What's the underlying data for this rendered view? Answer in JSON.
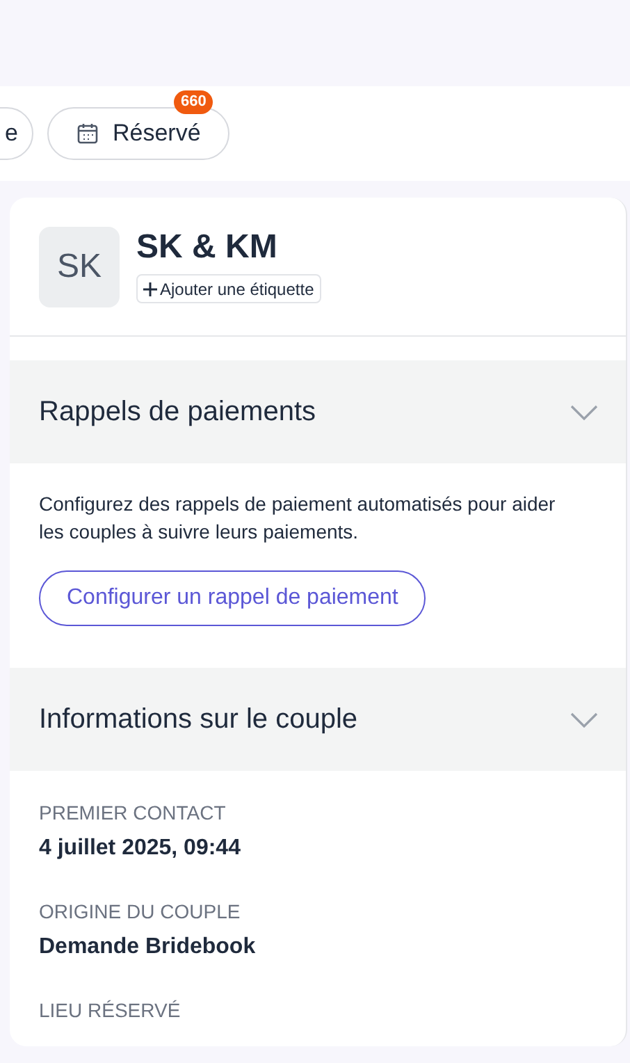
{
  "filters": [
    {
      "label": "e"
    },
    {
      "label": "Réservé",
      "badge": "660"
    }
  ],
  "couple": {
    "initials": "SK",
    "name": "SK & KM",
    "add_tag": "Ajouter une étiquette"
  },
  "sections": [
    {
      "kind": "action",
      "title": "Rappels de paiements",
      "expanded": true,
      "description": "Configurez des rappels de paiement automatisés pour aider les couples à suivre leurs paiements.",
      "button": "Configurer un rappel de paiement"
    },
    {
      "kind": "fields",
      "title": "Informations sur le couple",
      "expanded": true,
      "fields": [
        {
          "label": "PREMIER CONTACT",
          "value": "4 juillet 2025, 09:44"
        },
        {
          "label": "ORIGINE DU COUPLE",
          "value": "Demande Bridebook"
        },
        {
          "label": "LIEU RÉSERVÉ"
        }
      ]
    }
  ]
}
